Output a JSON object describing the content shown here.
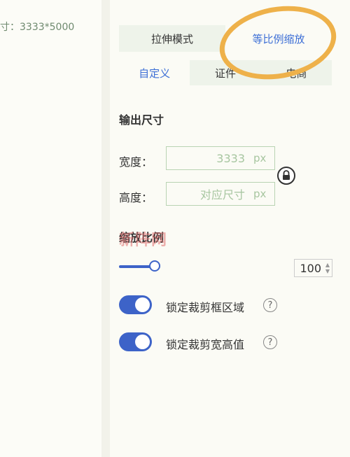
{
  "left": {
    "size_info": "寸：3333*5000"
  },
  "mode_tabs": [
    "拉伸模式",
    "等比例缩放"
  ],
  "sub_tabs": [
    "自定义",
    "证件",
    "电商"
  ],
  "output_size": {
    "title": "输出尺寸",
    "width_label": "宽度：",
    "width_value": "3333",
    "height_label": "高度：",
    "height_placeholder": "对应尺寸",
    "unit": "px"
  },
  "scale": {
    "title": "缩放比例",
    "value": "100",
    "level_percent": 100
  },
  "toggles": [
    {
      "label": "锁定裁剪框区域",
      "on": true
    },
    {
      "label": "锁定裁剪宽高值",
      "on": true
    }
  ],
  "help_symbol": "?",
  "watermark": "新阵网",
  "icons": {
    "lock": "lock-icon",
    "help": "help-circle-icon"
  },
  "colors": {
    "accent": "#3d63c8",
    "active_tab_text": "#3d6fd6",
    "input_border": "#b9d3b3",
    "highlight_ring": "#eeb14a"
  }
}
